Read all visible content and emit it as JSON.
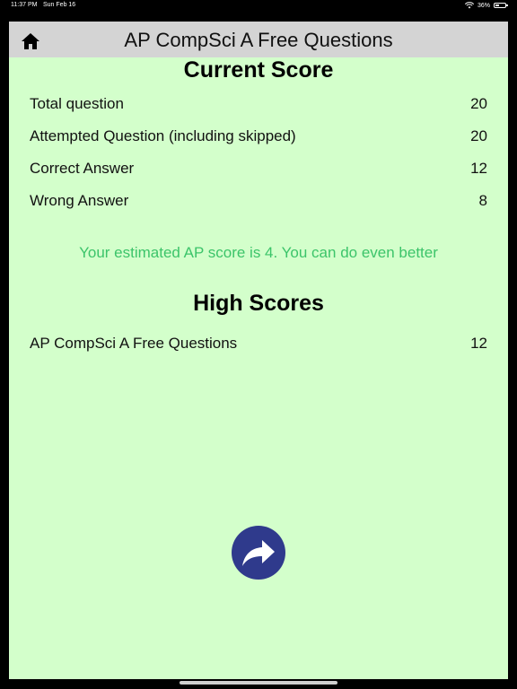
{
  "status_bar": {
    "time": "11:37 PM",
    "date": "Sun Feb 16",
    "battery": "36%",
    "wifi_icon": "wifi-icon",
    "battery_icon": "battery-icon"
  },
  "nav": {
    "title": "AP CompSci A Free Questions",
    "home_icon": "home-icon"
  },
  "current_score": {
    "title": "Current Score",
    "rows": [
      {
        "label": "Total question",
        "value": "20"
      },
      {
        "label": "Attempted Question (including skipped)",
        "value": "20"
      },
      {
        "label": "Correct Answer",
        "value": "12"
      },
      {
        "label": "Wrong Answer",
        "value": "8"
      }
    ]
  },
  "message": "Your estimated AP score is 4. You can do even better",
  "high_scores": {
    "title": "High Scores",
    "rows": [
      {
        "label": "AP CompSci A Free Questions",
        "value": "12"
      }
    ]
  },
  "next_button": {
    "icon": "share-forward-icon"
  },
  "colors": {
    "background": "#d3ffcb",
    "nav_bar": "#d4d4d4",
    "message": "#3cc46a",
    "button": "#2f3a8c"
  }
}
